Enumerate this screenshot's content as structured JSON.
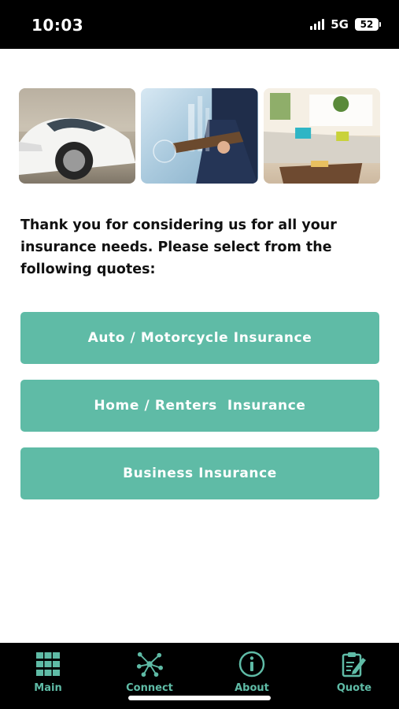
{
  "status_bar": {
    "time": "10:03",
    "network": "5G",
    "battery": "52"
  },
  "hero_images": [
    {
      "name": "sports-car-image"
    },
    {
      "name": "business-tablet-image"
    },
    {
      "name": "living-room-image"
    }
  ],
  "intro": {
    "text": "Thank you for considering us for all your insurance needs. Please select from the following quotes:"
  },
  "buttons": {
    "auto": "Auto / Motorcycle Insurance",
    "home": "Home / Renters  Insurance",
    "business": "Business Insurance"
  },
  "tabs": {
    "main": "Main",
    "connect": "Connect",
    "about": "About",
    "quote": "Quote"
  },
  "colors": {
    "accent": "#5fbba6",
    "bar_background": "#000000"
  },
  "icons": {
    "main": "grid-icon",
    "connect": "network-icon",
    "about": "info-icon",
    "quote": "clipboard-edit-icon"
  }
}
